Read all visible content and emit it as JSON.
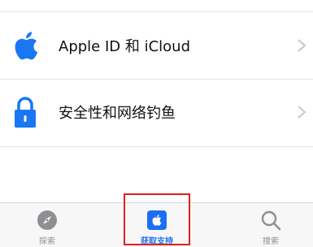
{
  "list": {
    "rows": [
      {
        "label": "Apple ID 和 iCloud",
        "icon": "apple-logo-icon",
        "color": "#1977f3"
      },
      {
        "label": "安全性和网络钓鱼",
        "icon": "lock-icon",
        "color": "#1977f3"
      }
    ]
  },
  "tabbar": {
    "tabs": [
      {
        "label": "探索",
        "icon": "compass-icon",
        "active": false
      },
      {
        "label": "获取支持",
        "icon": "apple-support-icon",
        "active": true
      },
      {
        "label": "搜索",
        "icon": "search-icon",
        "active": false
      }
    ]
  },
  "colors": {
    "accent": "#1977f3",
    "active_tab": "#1d6ff2",
    "inactive_tab": "#8e8e93",
    "highlight": "#e0201b"
  }
}
